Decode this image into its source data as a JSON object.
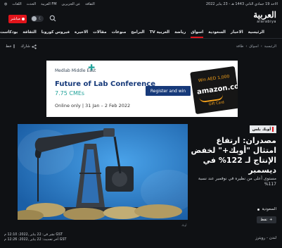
{
  "topbar": {
    "date": "الاحد 19 جمادي الثاني 1443 هـ - 23 يناير 2022",
    "links": [
      "الثقافة",
      "عن الجزيرين",
      "العربية FM",
      "الحدث",
      "اللغات"
    ]
  },
  "header": {
    "live_label": "مباشر",
    "brand_arabic": "العربية",
    "brand_latin": "alarabiya"
  },
  "nav": {
    "items": [
      "الرئيسية",
      "الاخبار",
      "السعودية",
      "اسواق",
      "رياضة",
      "العربية TV",
      "البرامج",
      "منوعات",
      "مقالات",
      "الاخيرة",
      "فيروس كورونا",
      "الثقافة",
      "بودكاست"
    ],
    "active_index": 3
  },
  "breadcrumb": {
    "items": [
      "الرئيسية",
      "اسواق",
      "طاقة"
    ]
  },
  "actions": {
    "share": "شارك",
    "font": "خط"
  },
  "ad": {
    "company": "Medlab Middle East",
    "title": "Future of Lab Conference",
    "cmes": "7.75 CMEs",
    "dates": "Online only | 31 Jan – 2 Feb 2022",
    "cta": "Register and win",
    "gift_win": "Win AED 1,000",
    "gift_brand": "amazon.com",
    "gift_card": "Gift Card",
    "colors": {
      "brand": "#173a7a",
      "teal": "#21a39a",
      "amazon": "#f6a21a"
    }
  },
  "article": {
    "tag": "أوبك بلس",
    "headline": "مصدران: ارتفاع امتثال \"أوبك+\" لخفض الإنتاج لـ 122% في ديسمبر",
    "sub": "مستوى أعلى من نظيره في نوفمبر عند نسبة 117%",
    "photo_credit": "أوبك",
    "country": "السعودية",
    "topic_chip": "نفط",
    "published": "نشر في: 22 يناير ,2022: 12:10 م GST",
    "updated": "آخر تحديث: 22 يناير ,2022: 12:26 م GST",
    "source": "لندن - رويترز"
  },
  "colors": {
    "accent": "#e1141b",
    "background": "#0f1114"
  }
}
